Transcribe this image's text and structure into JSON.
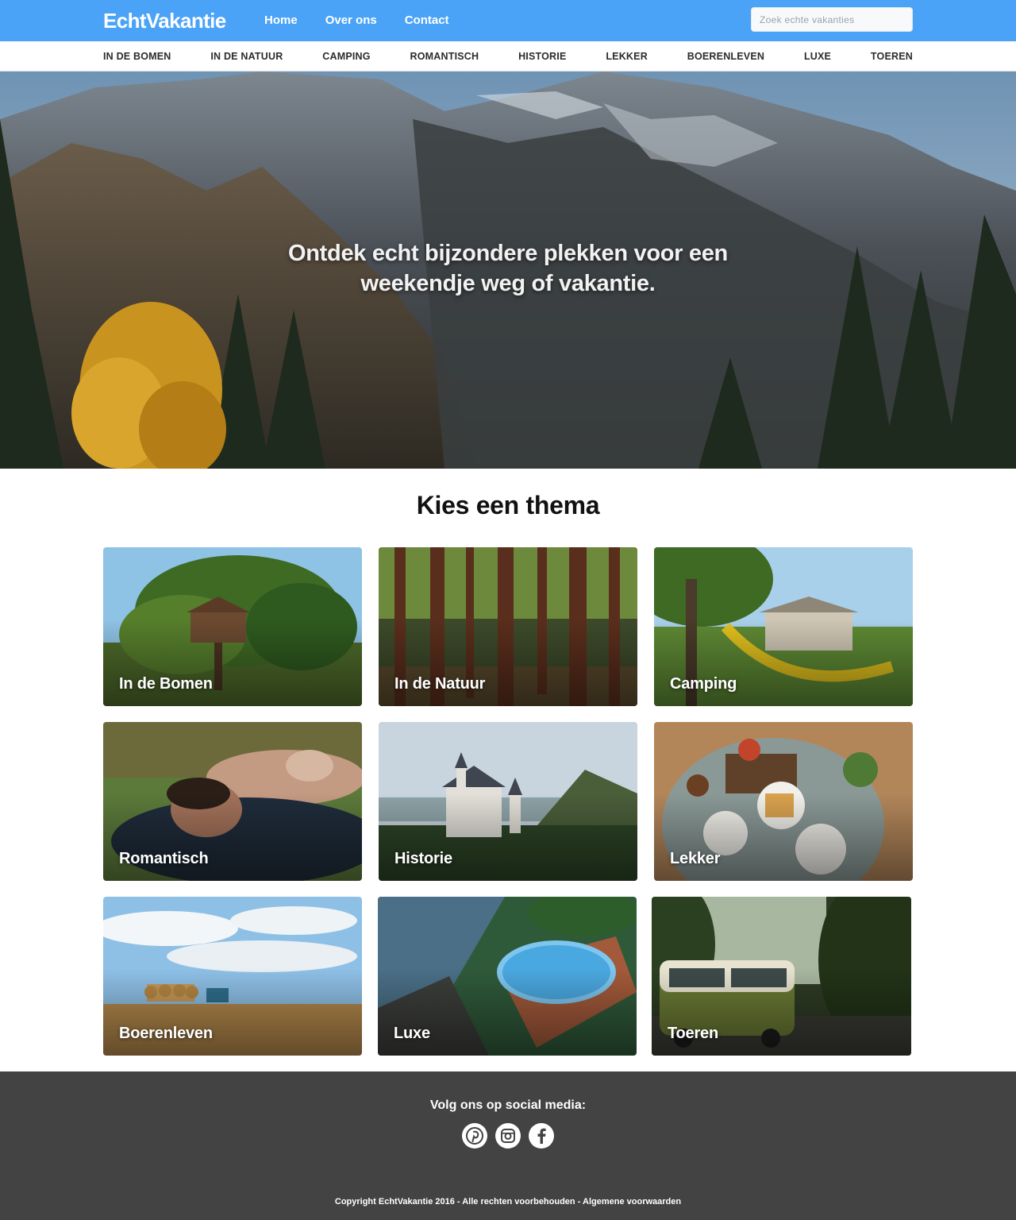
{
  "header": {
    "logo": "EchtVakantie",
    "nav": [
      "Home",
      "Over ons",
      "Contact"
    ],
    "search_placeholder": "Zoek echte vakanties"
  },
  "categories": [
    "IN DE BOMEN",
    "IN DE NATUUR",
    "CAMPING",
    "ROMANTISCH",
    "HISTORIE",
    "LEKKER",
    "BOERENLEVEN",
    "LUXE",
    "TOEREN"
  ],
  "hero": {
    "headline": "Ontdek echt bijzondere plekken voor een weekendje weg of vakantie."
  },
  "themes": {
    "title": "Kies een thema",
    "cards": [
      {
        "label": "In de Bomen",
        "image": "treehouse-photo"
      },
      {
        "label": "In de Natuur",
        "image": "forest-photo"
      },
      {
        "label": "Camping",
        "image": "tent-hammock-photo"
      },
      {
        "label": "Romantisch",
        "image": "couple-photo"
      },
      {
        "label": "Historie",
        "image": "castle-photo"
      },
      {
        "label": "Lekker",
        "image": "breakfast-table-photo"
      },
      {
        "label": "Boerenleven",
        "image": "hay-field-photo"
      },
      {
        "label": "Luxe",
        "image": "pool-photo"
      },
      {
        "label": "Toeren",
        "image": "campervan-photo"
      }
    ]
  },
  "footer": {
    "follow_label": "Volg ons op social media:",
    "socials": [
      "pinterest-icon",
      "instagram-icon",
      "facebook-icon"
    ],
    "copyright": "Copyright EchtVakantie 2016 - Alle rechten voorbehouden - Algemene voorwaarden"
  },
  "colors": {
    "topbar": "#4aa3f7",
    "footer": "#434343"
  }
}
